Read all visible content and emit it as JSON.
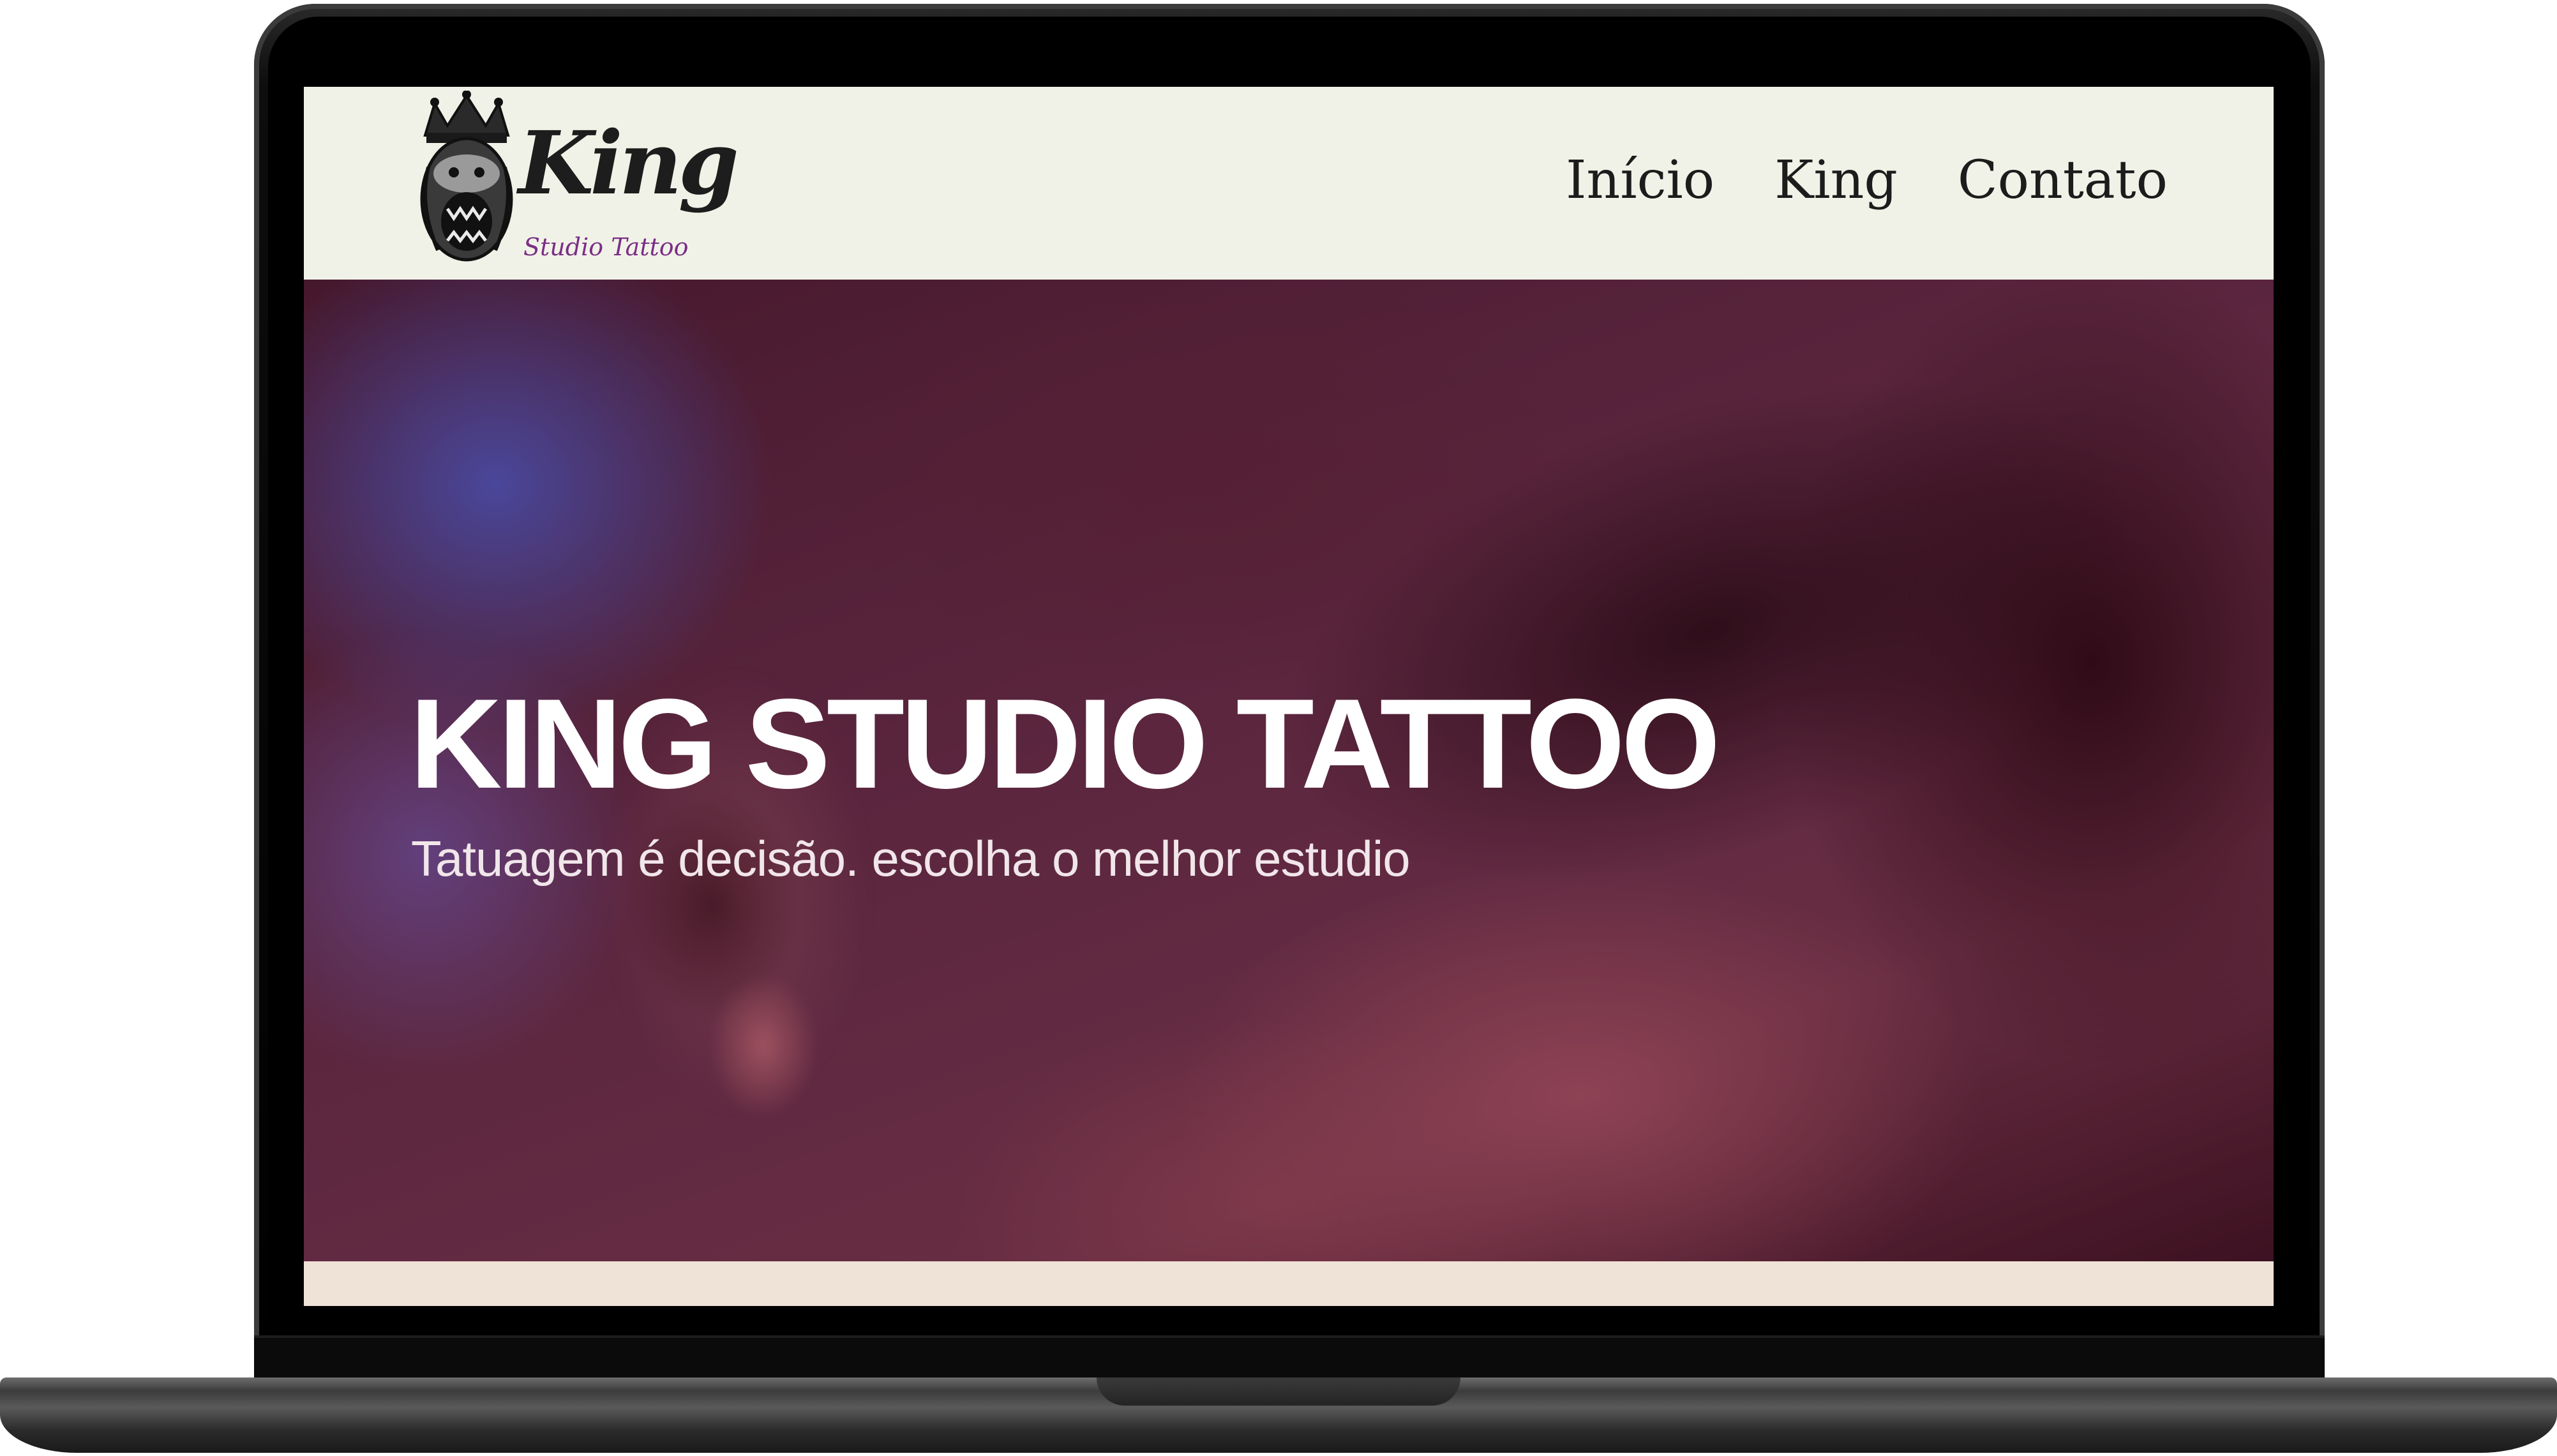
{
  "navbar": {
    "logo": {
      "word": "King",
      "subtitle": "Studio Tattoo",
      "emblem_icon": "gorilla-crown-icon"
    },
    "links": [
      "Início",
      "King",
      "Contato"
    ]
  },
  "hero": {
    "title": "KING STUDIO TATTOO",
    "subtitle": "Tatuagem é decisão. escolha o melhor estudio"
  },
  "colors": {
    "navbar_bg": "#f1f2e7",
    "logo_subtitle": "#7a2e86",
    "hero_text": "#ffffff",
    "below_hero_bg": "#efe2d6"
  }
}
